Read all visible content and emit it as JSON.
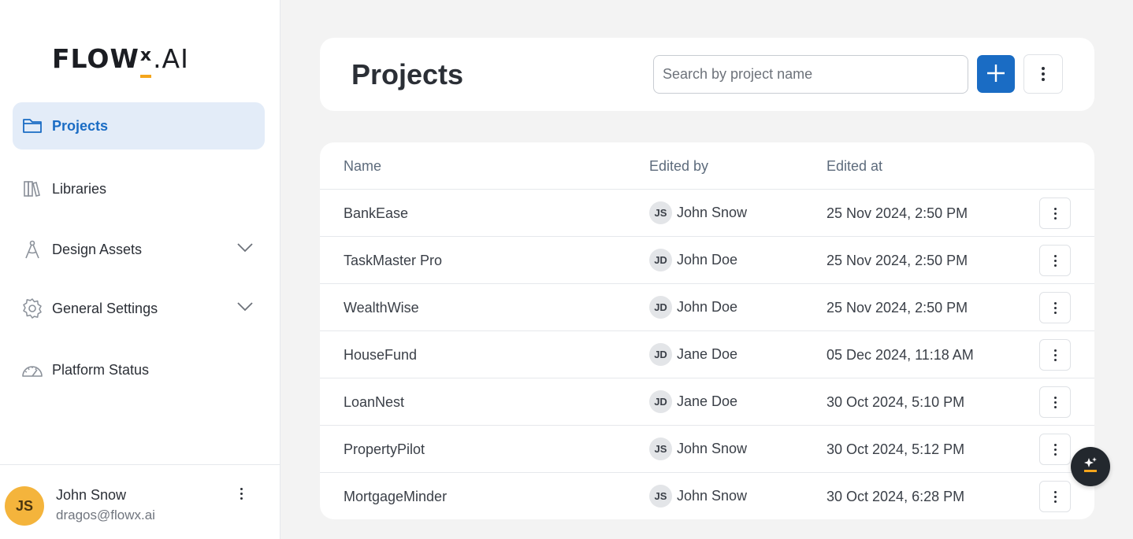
{
  "brand": {
    "logo_main": "FLOW",
    "logo_x": "x",
    "logo_suffix": ".AI",
    "accent": "#f4a51c"
  },
  "sidebar": {
    "items": [
      {
        "label": "Projects",
        "icon": "folder-icon",
        "active": true
      },
      {
        "label": "Libraries",
        "icon": "library-icon",
        "active": false
      },
      {
        "label": "Design Assets",
        "icon": "compass-icon",
        "expandable": true
      },
      {
        "label": "General Settings",
        "icon": "gear-icon",
        "expandable": true
      },
      {
        "label": "Platform Status",
        "icon": "gauge-icon",
        "active": false
      }
    ]
  },
  "user": {
    "initials": "JS",
    "name": "John Snow",
    "email": "dragos@flowx.ai"
  },
  "header": {
    "title": "Projects",
    "search_placeholder": "Search by project name",
    "search_value": ""
  },
  "table": {
    "columns": [
      "Name",
      "Edited by",
      "Edited at"
    ],
    "rows": [
      {
        "name": "BankEase",
        "initials": "JS",
        "editor": "John Snow",
        "date": "25 Nov 2024, 2:50 PM"
      },
      {
        "name": "TaskMaster Pro",
        "initials": "JD",
        "editor": "John Doe",
        "date": "25 Nov 2024, 2:50 PM"
      },
      {
        "name": "WealthWise",
        "initials": "JD",
        "editor": "John Doe",
        "date": "25 Nov 2024, 2:50 PM"
      },
      {
        "name": "HouseFund",
        "initials": "JD",
        "editor": "Jane Doe",
        "date": "05 Dec 2024, 11:18 AM"
      },
      {
        "name": "LoanNest",
        "initials": "JD",
        "editor": "Jane Doe",
        "date": "30 Oct 2024, 5:10 PM"
      },
      {
        "name": "PropertyPilot",
        "initials": "JS",
        "editor": "John Snow",
        "date": "30 Oct 2024, 5:12 PM"
      },
      {
        "name": "MortgageMinder",
        "initials": "JS",
        "editor": "John Snow",
        "date": "30 Oct 2024, 6:28 PM"
      }
    ]
  },
  "colors": {
    "primary": "#1a6cc4",
    "active_bg": "#e3ecf8",
    "avatar_user": "#f4b43c"
  }
}
